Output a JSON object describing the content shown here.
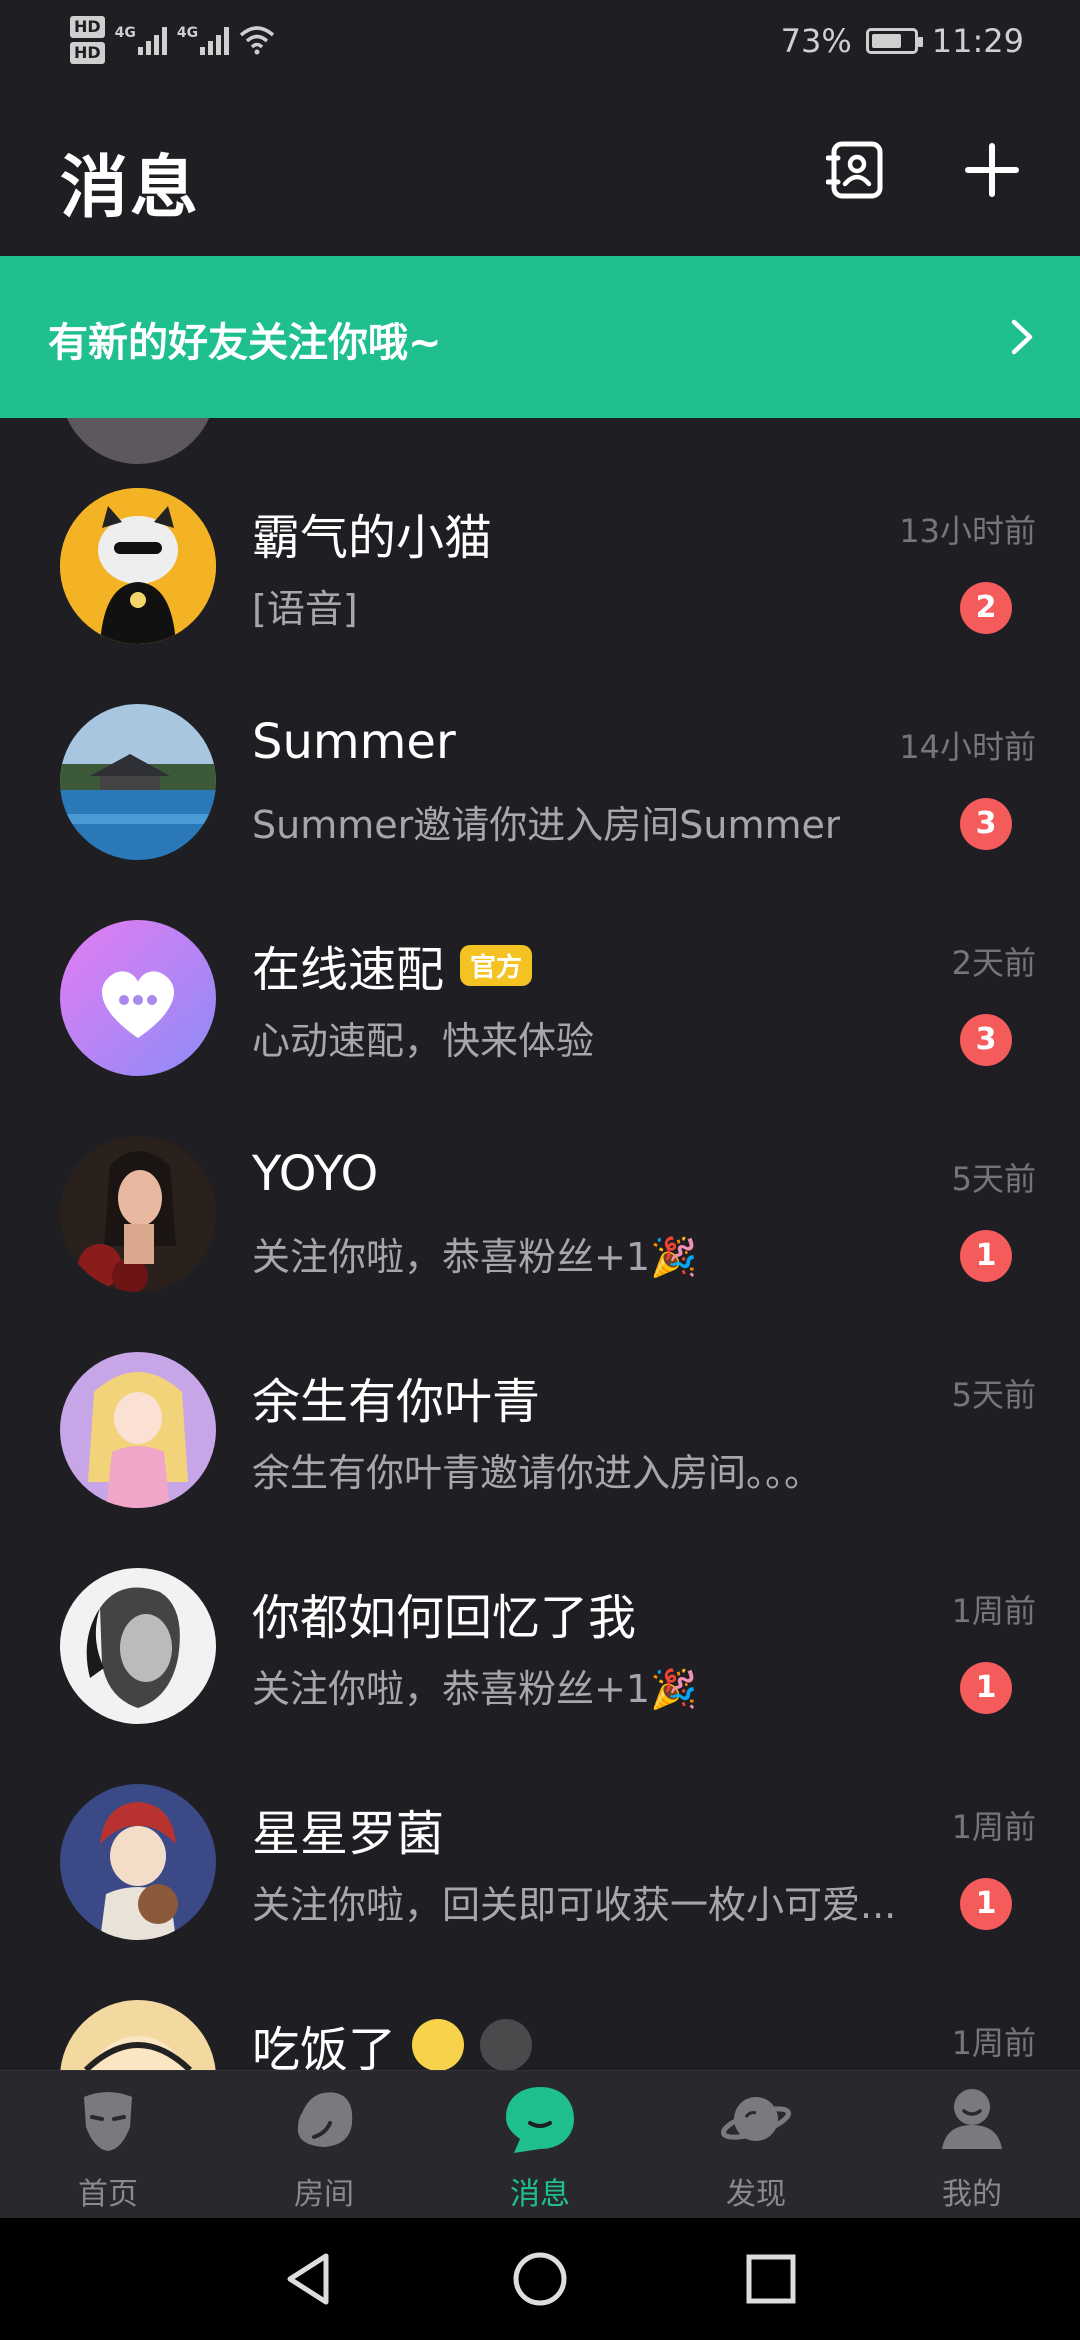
{
  "status_bar": {
    "hd1": "HD",
    "hd2": "HD",
    "net1": "4G",
    "net2": "4G",
    "battery_percent": "73%",
    "battery_level": 0.73,
    "time": "11:29"
  },
  "header": {
    "title": "消息",
    "icons": [
      "contacts-icon",
      "plus-icon"
    ]
  },
  "banner": {
    "text": "有新的好友关注你哦~",
    "icon": "chevron-right-icon"
  },
  "conversations": [
    {
      "name": "霸气的小猫",
      "preview": "[语音]",
      "time": "13小时前",
      "unread": "2"
    },
    {
      "name": "Summer",
      "preview": "Summer邀请你进入房间Summer",
      "time": "14小时前",
      "unread": "3"
    },
    {
      "name": "在线速配",
      "badge": "官方",
      "preview": "心动速配，快来体验",
      "time": "2天前",
      "unread": "3"
    },
    {
      "name": "YOYO",
      "preview": "关注你啦，恭喜粉丝+1🎉",
      "time": "5天前",
      "unread": "1"
    },
    {
      "name": "余生有你叶青",
      "preview": "余生有你叶青邀请你进入房间。。。",
      "time": "5天前",
      "unread": ""
    },
    {
      "name": "你都如何回忆了我",
      "preview": "关注你啦，恭喜粉丝+1🎉",
      "time": "1周前",
      "unread": "1"
    },
    {
      "name": "星星罗菌",
      "preview": "关注你啦，回关即可收获一枚小可爱...",
      "time": "1周前",
      "unread": "1"
    },
    {
      "name": "吃饭了",
      "preview": "",
      "time": "1周前",
      "unread": ""
    }
  ],
  "bottom_nav": [
    {
      "label": "首页",
      "icon": "mask-face-icon",
      "active": false
    },
    {
      "label": "房间",
      "icon": "room-blob-icon",
      "active": false
    },
    {
      "label": "消息",
      "icon": "chat-bubble-icon",
      "active": true
    },
    {
      "label": "发现",
      "icon": "planet-icon",
      "active": false
    },
    {
      "label": "我的",
      "icon": "person-icon",
      "active": false
    }
  ],
  "colors": {
    "accent": "#1fbf8f",
    "background": "#1f1e23",
    "unread_badge": "#f45b5b",
    "official_badge": "#f4c223"
  }
}
